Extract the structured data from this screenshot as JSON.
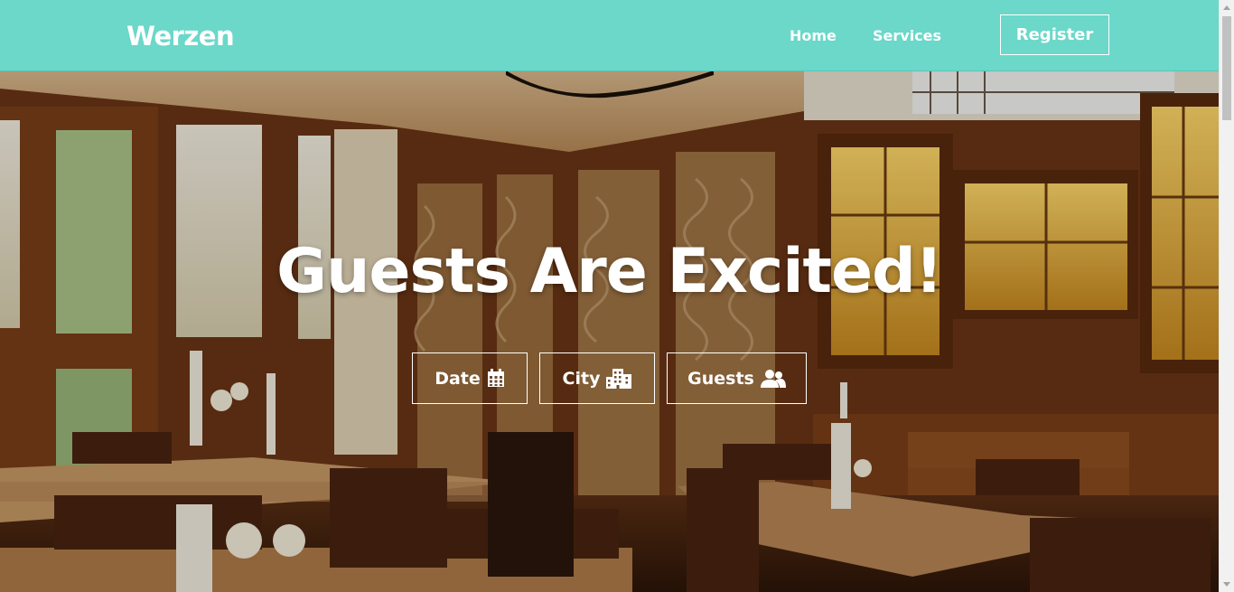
{
  "navbar": {
    "brand": "Werzen",
    "links": [
      {
        "label": "Home"
      },
      {
        "label": "Services"
      }
    ],
    "register_label": "Register",
    "background": "#6bd8c9"
  },
  "hero": {
    "title": "Guests Are Excited!",
    "buttons": [
      {
        "label": "Date",
        "icon": "calendar-icon"
      },
      {
        "label": "City",
        "icon": "city-icon"
      },
      {
        "label": "Guests",
        "icon": "users-icon"
      }
    ],
    "background_image": "restaurant-interior-photo"
  }
}
